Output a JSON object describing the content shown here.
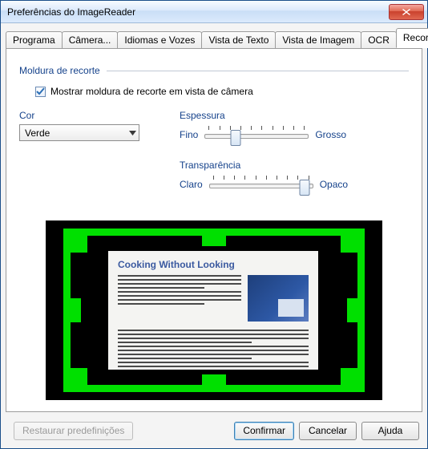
{
  "window": {
    "title": "Preferências do ImageReader"
  },
  "tabs": [
    {
      "label": "Programa"
    },
    {
      "label": "Câmera..."
    },
    {
      "label": "Idiomas e Vozes"
    },
    {
      "label": "Vista de Texto"
    },
    {
      "label": "Vista de Imagem"
    },
    {
      "label": "OCR"
    },
    {
      "label": "Recortar imagem",
      "active": true
    }
  ],
  "group": {
    "title": "Moldura de recorte"
  },
  "checkbox": {
    "label": "Mostrar moldura de recorte em vista de câmera",
    "checked": true
  },
  "color": {
    "label": "Cor",
    "value": "Verde"
  },
  "thickness": {
    "label": "Espessura",
    "minLabel": "Fino",
    "maxLabel": "Grosso",
    "posPercent": 30
  },
  "transparency": {
    "label": "Transparência",
    "minLabel": "Claro",
    "maxLabel": "Opaco",
    "posPercent": 92
  },
  "preview": {
    "doc_title": "Cooking Without Looking"
  },
  "buttons": {
    "restore": "Restaurar predefinições",
    "confirm": "Confirmar",
    "cancel": "Cancelar",
    "help": "Ajuda"
  }
}
